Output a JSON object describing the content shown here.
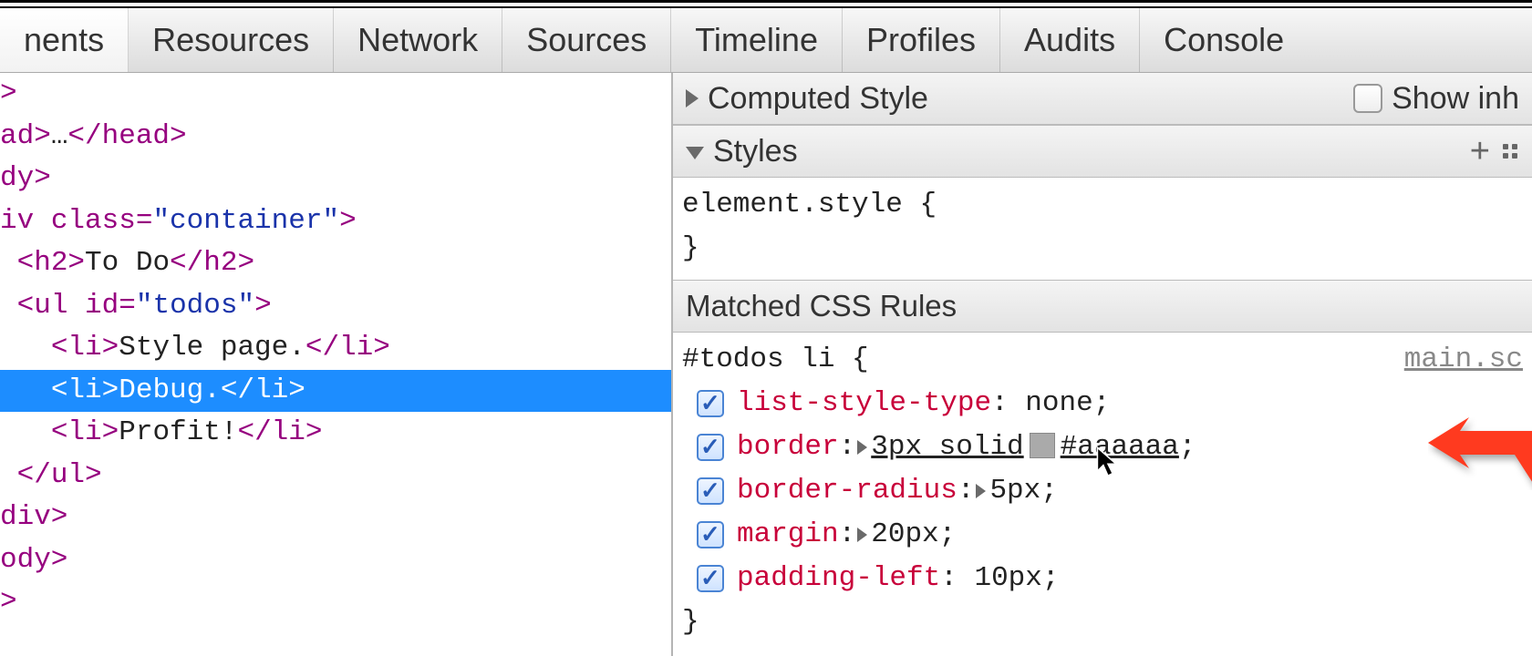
{
  "tabs": {
    "elements": "nents",
    "resources": "Resources",
    "network": "Network",
    "sources": "Sources",
    "timeline": "Timeline",
    "profiles": "Profiles",
    "audits": "Audits",
    "console": "Console"
  },
  "dom": {
    "l0": ">",
    "head_open": "ad>",
    "head_ellipsis": "…",
    "head_close": "</head>",
    "body_open": "dy>",
    "div_open_pre": "iv ",
    "div_attr_name": "class",
    "div_attr_eq": "=",
    "div_attr_val": "\"container\"",
    "div_open_post": ">",
    "h2_open": "<h2>",
    "h2_text": "To Do",
    "h2_close": "</h2>",
    "ul_open_pre": "<ul ",
    "ul_attr_name": "id",
    "ul_attr_eq": "=",
    "ul_attr_val": "\"todos\"",
    "ul_open_post": ">",
    "li1_open": "<li>",
    "li1_text": "Style page.",
    "li1_close": "</li>",
    "li2_open": "<li>",
    "li2_text": "Debug.",
    "li2_close": "</li>",
    "li3_open": "<li>",
    "li3_text": "Profit!",
    "li3_close": "</li>",
    "ul_close": "</ul>",
    "div_close": "div>",
    "body_close": "ody>",
    "html_close": ">"
  },
  "sections": {
    "computed": "Computed Style",
    "show_inherited": "Show inh",
    "styles": "Styles",
    "matched": "Matched CSS Rules"
  },
  "element_style": {
    "open": "element.style {",
    "close": "}"
  },
  "rule": {
    "selector": "#todos li {",
    "source": "main.sc",
    "close": "}",
    "decls": {
      "p0": {
        "name": "list-style-type",
        "value": "none"
      },
      "p1": {
        "name": "border",
        "value_a": "3px solid",
        "value_b": "#aaaaaa"
      },
      "p2": {
        "name": "border-radius",
        "value": "5px"
      },
      "p3": {
        "name": "margin",
        "value": "20px"
      },
      "p4": {
        "name": "padding-left",
        "value": "10px"
      }
    }
  },
  "icons": {
    "plus": "+",
    "checkbox_label": ""
  },
  "colors": {
    "selection": "#1d8dff",
    "tag": "#96007f",
    "prop": "#c8003a",
    "swatch": "#aaaaaa",
    "arrow": "#ff3a1f"
  }
}
